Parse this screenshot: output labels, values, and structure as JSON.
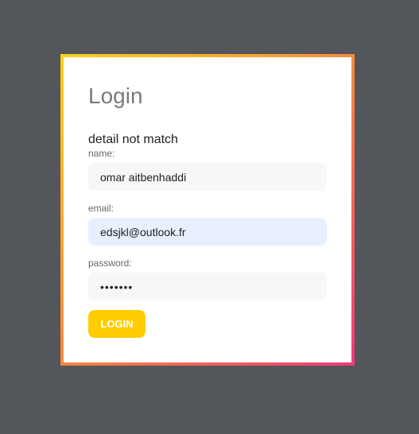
{
  "form": {
    "title": "Login",
    "error_message": "detail not match",
    "name_label": "name:",
    "name_value": "omar aitbenhaddi",
    "email_label": "email:",
    "email_value": "edsjkl@outlook.fr",
    "password_label": "password:",
    "password_value": "1234567",
    "submit_label": "LOGIN"
  },
  "colors": {
    "background": "#53565b",
    "gradient_start": "#ffd11a",
    "gradient_end": "#ef3b7a",
    "button": "#ffcc00",
    "autofill": "#e8f0fe"
  }
}
